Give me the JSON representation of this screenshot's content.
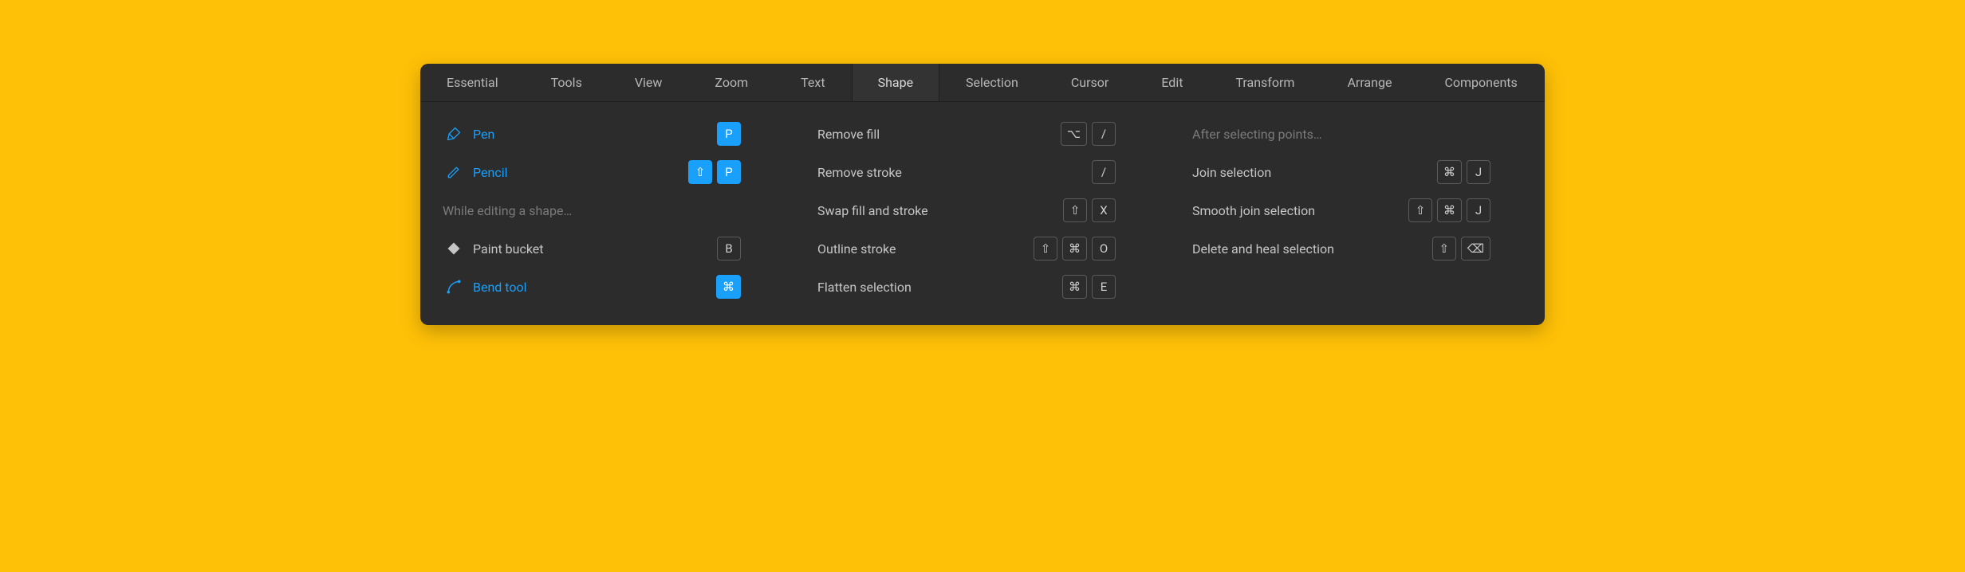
{
  "colors": {
    "accent": "#18a0fb",
    "panel": "#2c2c2c",
    "page": "#ffc107"
  },
  "tabs": [
    {
      "label": "Essential",
      "active": false
    },
    {
      "label": "Tools",
      "active": false
    },
    {
      "label": "View",
      "active": false
    },
    {
      "label": "Zoom",
      "active": false
    },
    {
      "label": "Text",
      "active": false
    },
    {
      "label": "Shape",
      "active": true
    },
    {
      "label": "Selection",
      "active": false
    },
    {
      "label": "Cursor",
      "active": false
    },
    {
      "label": "Edit",
      "active": false
    },
    {
      "label": "Transform",
      "active": false
    },
    {
      "label": "Arrange",
      "active": false
    },
    {
      "label": "Components",
      "active": false
    }
  ],
  "col1": {
    "pen": {
      "label": "Pen",
      "key": "P"
    },
    "pencil": {
      "label": "Pencil",
      "keys": [
        "⇧",
        "P"
      ]
    },
    "heading": {
      "label": "While editing a shape…"
    },
    "bucket": {
      "label": "Paint bucket",
      "key": "B"
    },
    "bend": {
      "label": "Bend tool",
      "key": "⌘"
    }
  },
  "col2": {
    "removeFill": {
      "label": "Remove fill",
      "keys": [
        "⌥",
        "/"
      ]
    },
    "removeStroke": {
      "label": "Remove stroke",
      "keys": [
        "/"
      ]
    },
    "swap": {
      "label": "Swap fill and stroke",
      "keys": [
        "⇧",
        "X"
      ]
    },
    "outline": {
      "label": "Outline stroke",
      "keys": [
        "⇧",
        "⌘",
        "O"
      ]
    },
    "flatten": {
      "label": "Flatten selection",
      "keys": [
        "⌘",
        "E"
      ]
    }
  },
  "col3": {
    "heading": {
      "label": "After selecting points…"
    },
    "join": {
      "label": "Join selection",
      "keys": [
        "⌘",
        "J"
      ]
    },
    "smooth": {
      "label": "Smooth join selection",
      "keys": [
        "⇧",
        "⌘",
        "J"
      ]
    },
    "delete": {
      "label": "Delete and heal selection",
      "keys": [
        "⇧",
        "⌫"
      ]
    }
  }
}
